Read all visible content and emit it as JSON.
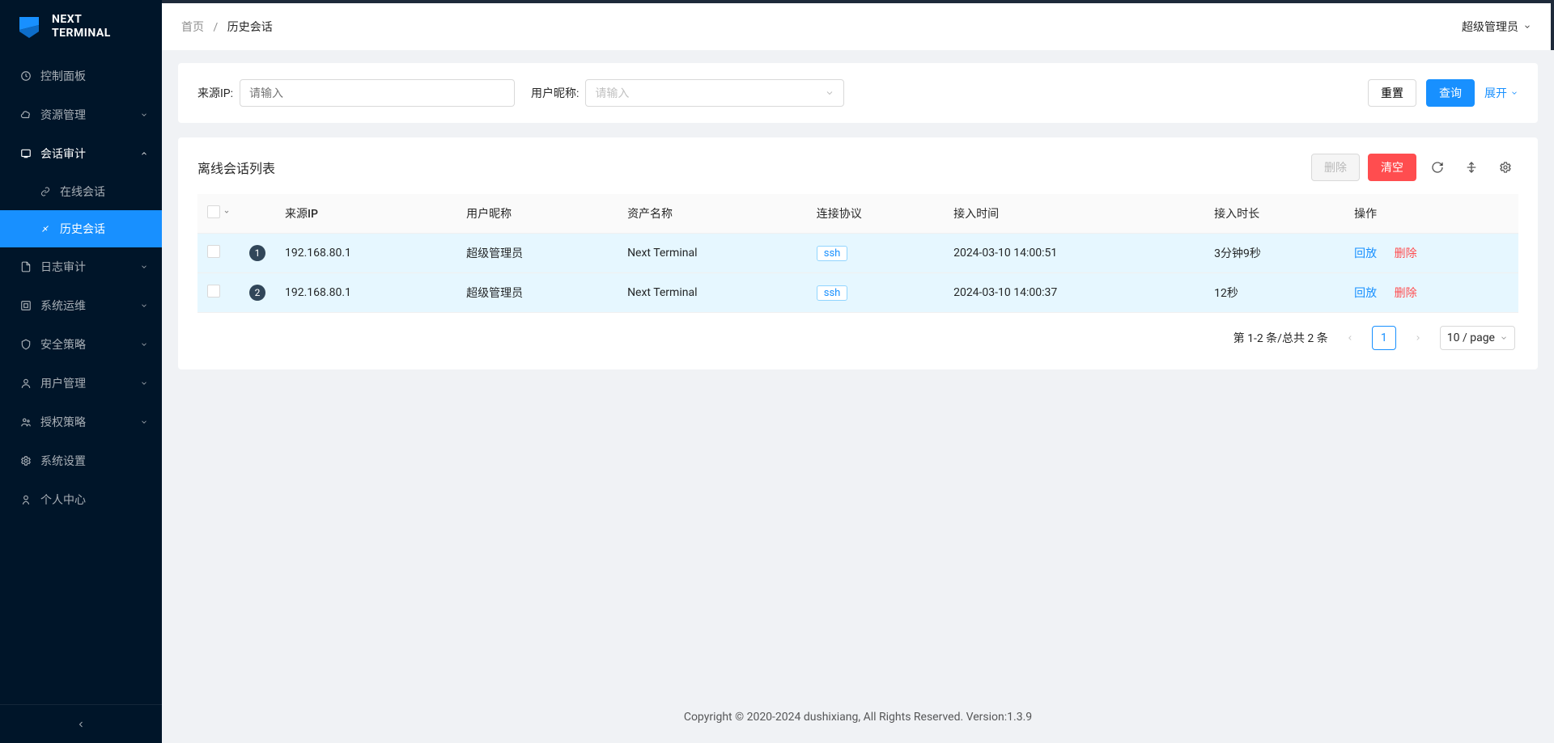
{
  "brand": {
    "line1": "NEXT",
    "line2": "TERMINAL"
  },
  "sidebar": {
    "items": [
      {
        "label": "控制面板"
      },
      {
        "label": "资源管理"
      },
      {
        "label": "会话审计"
      },
      {
        "label": "日志审计"
      },
      {
        "label": "系统运维"
      },
      {
        "label": "安全策略"
      },
      {
        "label": "用户管理"
      },
      {
        "label": "授权策略"
      },
      {
        "label": "系统设置"
      },
      {
        "label": "个人中心"
      }
    ],
    "session_children": [
      {
        "label": "在线会话"
      },
      {
        "label": "历史会话"
      }
    ]
  },
  "breadcrumb": {
    "home": "首页",
    "current": "历史会话"
  },
  "header": {
    "user": "超级管理员"
  },
  "search": {
    "source_ip_label": "来源IP:",
    "source_ip_placeholder": "请输入",
    "nickname_label": "用户昵称:",
    "nickname_placeholder": "请输入",
    "reset": "重置",
    "query": "查询",
    "expand": "展开"
  },
  "table": {
    "title": "离线会话列表",
    "toolbar": {
      "delete": "删除",
      "clear": "清空"
    },
    "columns": {
      "source_ip": "来源IP",
      "nickname": "用户昵称",
      "asset": "资产名称",
      "protocol": "连接协议",
      "time": "接入时间",
      "duration": "接入时长",
      "actions": "操作"
    },
    "rows": [
      {
        "idx": "1",
        "source_ip": "192.168.80.1",
        "nickname": "超级管理员",
        "asset": "Next Terminal",
        "protocol": "ssh",
        "time": "2024-03-10 14:00:51",
        "duration": "3分钟9秒"
      },
      {
        "idx": "2",
        "source_ip": "192.168.80.1",
        "nickname": "超级管理员",
        "asset": "Next Terminal",
        "protocol": "ssh",
        "time": "2024-03-10 14:00:37",
        "duration": "12秒"
      }
    ],
    "action_labels": {
      "replay": "回放",
      "delete": "删除"
    }
  },
  "pagination": {
    "total_text": "第 1-2 条/总共 2 条",
    "current": "1",
    "page_size": "10 / page"
  },
  "footer": "Copyright © 2020-2024 dushixiang, All Rights Reserved. Version:1.3.9"
}
